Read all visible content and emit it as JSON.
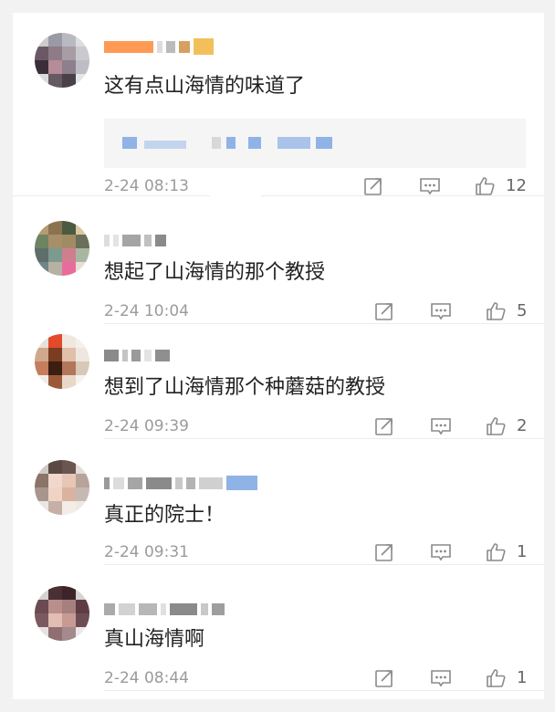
{
  "comments": [
    {
      "text": "这有点山海情的味道了",
      "time": "2-24 08:13",
      "likes": "12",
      "has_quote": true
    },
    {
      "text": "想起了山海情的那个教授",
      "time": "2-24 10:04",
      "likes": "5"
    },
    {
      "text": "想到了山海情那个种蘑菇的教授",
      "time": "2-24 09:39",
      "likes": "2"
    },
    {
      "text": "真正的院士！",
      "time": "2-24 09:31",
      "likes": "1"
    },
    {
      "text": "真山海情啊",
      "time": "2-24 08:44",
      "likes": "1"
    }
  ],
  "icons": {
    "repost": "repost-icon",
    "comment": "comment-icon",
    "like": "thumbs-up-icon"
  },
  "colors": {
    "icon": "#8a8a8a",
    "time": "#9b9b9b",
    "username_highlight": "#ff8a3d",
    "quote_link": "#8fb3e6"
  }
}
